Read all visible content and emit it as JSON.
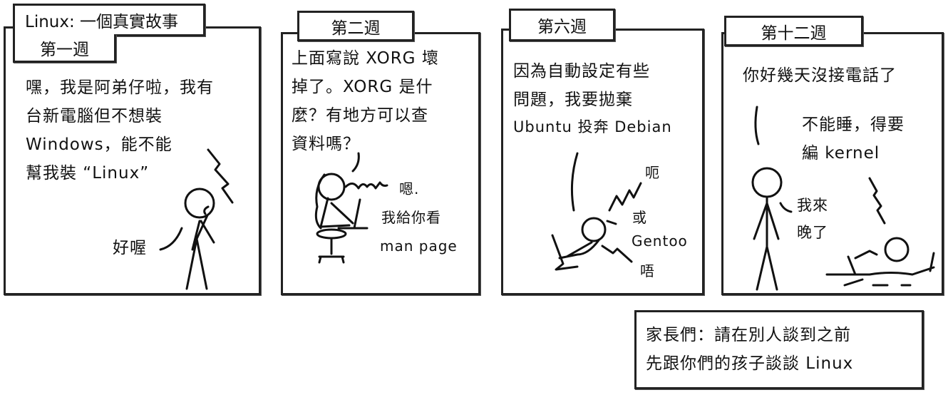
{
  "comic": {
    "title": "Linux: 一個真實故事",
    "panels": [
      {
        "caption": "第一週",
        "lines": [
          "嘿，我是阿弟仔啦，我有",
          "台新電腦但不想裝",
          "Windows，能不能",
          "幫我裝 “Linux”"
        ],
        "reply": "好喔"
      },
      {
        "caption": "第二週",
        "lines": [
          "上面寫說 XORG 壞",
          "掉了。XORG 是什",
          "麼？有地方可以查",
          "資料嗎？"
        ],
        "reply_lines": [
          "嗯.",
          "我給你看",
          "man page"
        ]
      },
      {
        "caption": "第六週",
        "lines": [
          "因為自動設定有些",
          "問題，我要拋棄",
          "Ubuntu 投奔 Debian"
        ],
        "reply_1": "呃",
        "reply_2_lines": [
          "或",
          "Gentoo"
        ],
        "reply_3": "唔"
      },
      {
        "caption": "第十二週",
        "line": "你好幾天沒接電話了",
        "kid_lines": [
          "不能睡，得要",
          "編 kernel"
        ],
        "reply_lines": [
          "我來",
          "晚了"
        ]
      }
    ],
    "footer_lines": [
      "家長們：請在別人談到之前",
      "先跟你們的孩子談談 Linux"
    ]
  }
}
